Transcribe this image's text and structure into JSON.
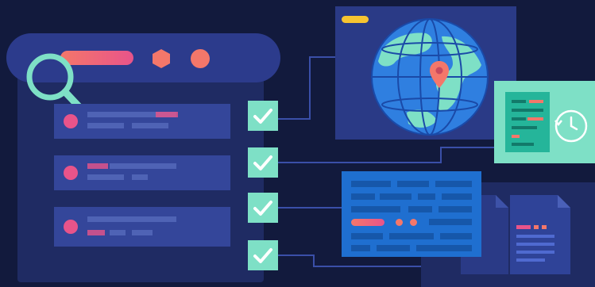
{
  "colors": {
    "background": "#121a3d",
    "panel_dark": "#1f2b63",
    "panel_mid": "#2a3a86",
    "row": "#34469a",
    "row_line": "#4f63b5",
    "teal": "#7ee0c6",
    "coral": "#f4776a",
    "pink": "#e8548a",
    "yellow": "#f6c431",
    "blue_card": "#1f6fd0",
    "globe_blue": "#2f7fe0"
  },
  "icons": {
    "magnifier": "magnifier-icon",
    "check": "check-icon",
    "globe": "globe-icon",
    "map_pin": "map-pin-icon",
    "clock": "clock-icon",
    "document": "document-icon"
  },
  "search_results": {
    "rows": [
      {
        "id": "row-1"
      },
      {
        "id": "row-2"
      },
      {
        "id": "row-3"
      }
    ]
  },
  "checks": [
    {
      "id": "check-1"
    },
    {
      "id": "check-2"
    },
    {
      "id": "check-3"
    },
    {
      "id": "check-4"
    }
  ]
}
